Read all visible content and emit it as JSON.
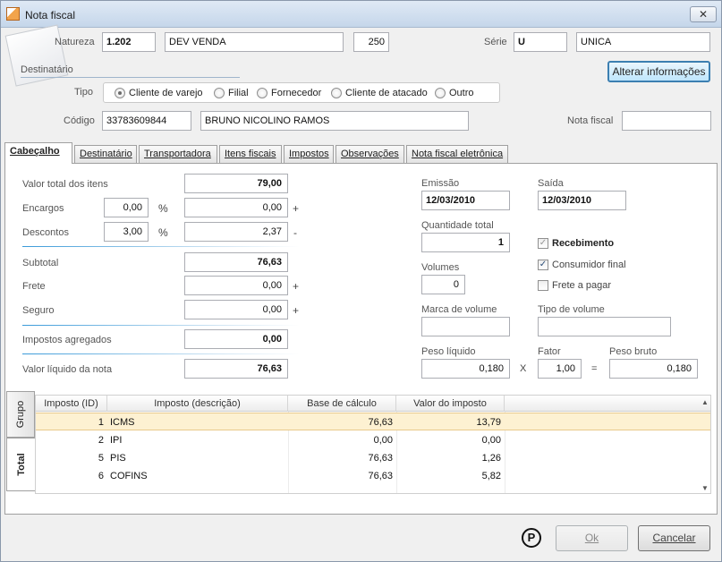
{
  "window": {
    "title": "Nota fiscal",
    "close_glyph": "✕"
  },
  "header": {
    "natureza_label": "Natureza",
    "natureza_code": "1.202",
    "natureza_desc": "DEV VENDA",
    "natureza_num": "250",
    "serie_label": "Série",
    "serie_code": "U",
    "serie_desc": "UNICA",
    "destinatario_label": "Destinatário",
    "alterar_button": "Alterar informações",
    "tipo_label": "Tipo",
    "tipo_options": [
      "Cliente de varejo",
      "Filial",
      "Fornecedor",
      "Cliente de atacado",
      "Outro"
    ],
    "tipo_selected": "Cliente de varejo",
    "codigo_label": "Código",
    "codigo_value": "33783609844",
    "nome_value": "BRUNO NICOLINO RAMOS",
    "nota_fiscal_label": "Nota fiscal",
    "nota_fiscal_value": ""
  },
  "tabs": [
    "Cabeçalho",
    "Destinatário",
    "Transportadora",
    "Itens fiscais",
    "Impostos",
    "Observações",
    "Nota fiscal eletrônica"
  ],
  "active_tab": "Cabeçalho",
  "totals": {
    "valor_total_label": "Valor total dos itens",
    "valor_total": "79,00",
    "encargos_label": "Encargos",
    "encargos_pct": "0,00",
    "encargos_val": "0,00",
    "descontos_label": "Descontos",
    "descontos_pct": "3,00",
    "descontos_val": "2,37",
    "subtotal_label": "Subtotal",
    "subtotal": "76,63",
    "frete_label": "Frete",
    "frete": "0,00",
    "seguro_label": "Seguro",
    "seguro": "0,00",
    "impostos_label": "Impostos agregados",
    "impostos": "0,00",
    "liquido_label": "Valor líquido da nota",
    "liquido": "76,63",
    "pct_symbol": "%",
    "plus": "+",
    "minus": "-"
  },
  "shipping": {
    "emissao_label": "Emissão",
    "emissao": "12/03/2010",
    "saida_label": "Saída",
    "saida": "12/03/2010",
    "quantidade_label": "Quantidade total",
    "quantidade": "1",
    "volumes_label": "Volumes",
    "volumes": "0",
    "marca_label": "Marca de volume",
    "marca": "",
    "tipo_volume_label": "Tipo de volume",
    "tipo_volume": "",
    "peso_liquido_label": "Peso líquido",
    "peso_liquido": "0,180",
    "fator_label": "Fator",
    "fator": "1,00",
    "peso_bruto_label": "Peso bruto",
    "peso_bruto": "0,180",
    "times": "X",
    "equals": "=",
    "recebimento_label": "Recebimento",
    "recebimento_checked": true,
    "consumidor_label": "Consumidor final",
    "consumidor_checked": true,
    "frete_pagar_label": "Frete a pagar",
    "frete_pagar_checked": false
  },
  "side_tabs": [
    "Grupo",
    "Total"
  ],
  "tax_table": {
    "columns": [
      "Imposto (ID)",
      "Imposto (descrição)",
      "Base de cálculo",
      "Valor do imposto"
    ],
    "rows": [
      {
        "id": "1",
        "desc": "ICMS",
        "base": "76,63",
        "valor": "13,79"
      },
      {
        "id": "2",
        "desc": "IPI",
        "base": "0,00",
        "valor": "0,00"
      },
      {
        "id": "5",
        "desc": "PIS",
        "base": "76,63",
        "valor": "1,26"
      },
      {
        "id": "6",
        "desc": "COFINS",
        "base": "76,63",
        "valor": "5,82"
      }
    ]
  },
  "footer": {
    "copyright_symbol": "P",
    "ok_button": "Ok",
    "cancel_button": "Cancelar"
  }
}
